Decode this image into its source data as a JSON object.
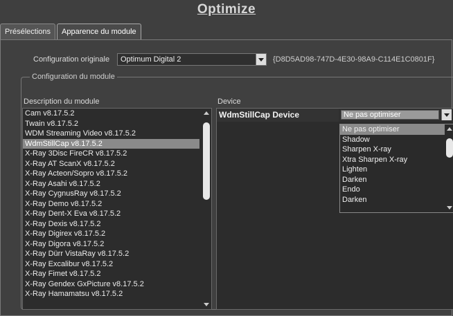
{
  "window": {
    "title": "Optimize"
  },
  "tabs": [
    {
      "label": "Présélections",
      "active": false
    },
    {
      "label": "Apparence du module",
      "active": true
    }
  ],
  "config": {
    "label": "Configuration originale",
    "value": "Optimum Digital 2",
    "guid": "{D8D5AD98-747D-4E30-98A9-C114E1C0801F}"
  },
  "module_group": {
    "legend": "Configuration du module",
    "description_header": "Description du module",
    "device_header": "Device",
    "modules": [
      "Cam v8.17.5.2",
      "Twain v8.17.5.2",
      "WDM Streaming Video v8.17.5.2",
      "WdmStillCap v8.17.5.2",
      "X-Ray 3Disc FireCR v8.17.5.2",
      "X-Ray AT ScanX v8.17.5.2",
      "X-Ray Acteon/Sopro v8.17.5.2",
      "X-Ray Asahi v8.17.5.2",
      "X-Ray CygnusRay v8.17.5.2",
      "X-Ray Demo v8.17.5.2",
      "X-Ray Dent-X Eva v8.17.5.2",
      "X-Ray Dexis v8.17.5.2",
      "X-Ray Digirex v8.17.5.2",
      "X-Ray Digora v8.17.5.2",
      "X-Ray Dürr VistaRay v8.17.5.2",
      "X-Ray Excalibur v8.17.5.2",
      "X-Ray Fimet v8.17.5.2",
      "X-Ray Gendex GxPicture v8.17.5.2",
      "X-Ray Hamamatsu v8.17.5.2"
    ],
    "selected_module_index": 3,
    "device_name": "WdmStillCap Device",
    "device_value": "Ne pas optimiser",
    "device_options": [
      "Ne pas optimiser",
      "Shadow",
      "Sharpen X-ray",
      "Xtra Sharpen X-ray",
      "Lighten",
      "Darken",
      "Endo",
      "Darken"
    ],
    "selected_option_index": 0
  },
  "colors": {
    "background": "#3f3f3f",
    "list_background": "#2c2c2c",
    "selection": "#8a8a8a"
  }
}
